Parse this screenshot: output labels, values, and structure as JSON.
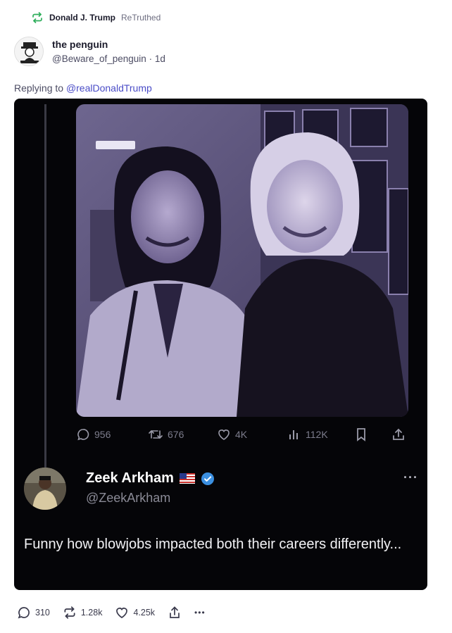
{
  "retruth": {
    "name": "Donald J. Trump",
    "label": "ReTruthed",
    "color": "#2eae5b"
  },
  "author": {
    "display_name": "the penguin",
    "handle": "@Beware_of_penguin",
    "separator": "·",
    "age": "1d"
  },
  "reply": {
    "prefix": "Replying to",
    "mention": "@realDonaldTrump"
  },
  "embedded_post": {
    "stats": {
      "replies": "956",
      "reposts": "676",
      "likes": "4K",
      "views": "112K"
    },
    "icons": [
      "reply-icon",
      "repost-icon",
      "like-icon",
      "views-icon",
      "bookmark-icon",
      "share-icon"
    ],
    "author": {
      "name": "Zeek Arkham",
      "handle": "@ZeekArkham",
      "flag": "us-flag",
      "verified": "verified-badge"
    },
    "more": "···",
    "text": "Funny how blowjobs impacted both their careers differently..."
  },
  "actions": {
    "replies": "310",
    "retruths": "1.28k",
    "likes": "4.25k",
    "more": "•••"
  },
  "colors": {
    "link": "#4a4cc7",
    "embed_bg": "#050508",
    "photo_tint": "#8c7fb8"
  }
}
